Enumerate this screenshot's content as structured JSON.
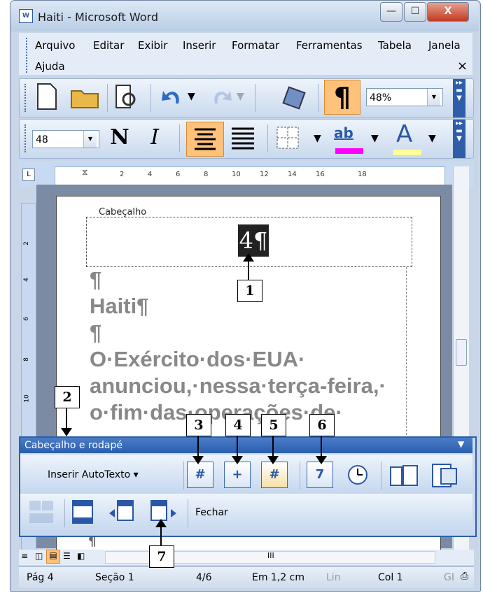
{
  "window": {
    "title": "Haiti - Microsoft Word",
    "app_icon": "word-doc-icon",
    "minimize_icon": "minimize-icon",
    "maximize_icon": "maximize-icon",
    "close_icon": "close-icon",
    "close_glyph": "X"
  },
  "menu": {
    "items": [
      "Arquivo",
      "Editar",
      "Exibir",
      "Inserir",
      "Formatar",
      "Ferramentas",
      "Tabela",
      "Janela",
      "Ajuda"
    ],
    "close_glyph": "×"
  },
  "toolbar_standard": {
    "zoom": "48%"
  },
  "toolbar_formatting": {
    "font_size": "48",
    "bold_label": "N",
    "italic_label": "I",
    "highlight_label": "ab",
    "font_color_label": "A"
  },
  "colors": {
    "highlight_bar": "#ff00ff",
    "font_color_bar": "#ffff99",
    "selected_button": "#ffc27a",
    "panel_title": "#2e5ea8"
  },
  "ruler": {
    "marks": [
      "2",
      "4",
      "6",
      "8",
      "10",
      "12",
      "14",
      "16",
      "18"
    ]
  },
  "vruler": {
    "marks": [
      "2",
      "4",
      "6",
      "8",
      "10"
    ]
  },
  "document": {
    "header_label": "Cabeçalho",
    "page_number_field": "4¶",
    "lines": [
      "¶",
      "Haiti¶",
      "¶",
      "O·Exército·dos·EUA·",
      "anunciou,·nessa·terça-feira,·",
      "o·fim·das·operações·de·"
    ],
    "bottom_pilcrow": "¶"
  },
  "callouts": [
    "1",
    "2",
    "3",
    "4",
    "5",
    "6",
    "7"
  ],
  "header_footer_toolbar": {
    "title": "Cabeçalho e rodapé",
    "insert_autotext": "Inserir AutoTexto ▾",
    "close_label": "Fechar",
    "page_number_icon": "#",
    "pages_count_icon": "+",
    "format_page_number_icon": "#",
    "date_icon": "7",
    "time_icon": "clock-icon"
  },
  "status": {
    "page": "Pág 4",
    "section": "Seção 1",
    "pages": "4/6",
    "at": "Em 1,2 cm",
    "line": "Lin",
    "column": "Col 1",
    "gr": "GI"
  }
}
